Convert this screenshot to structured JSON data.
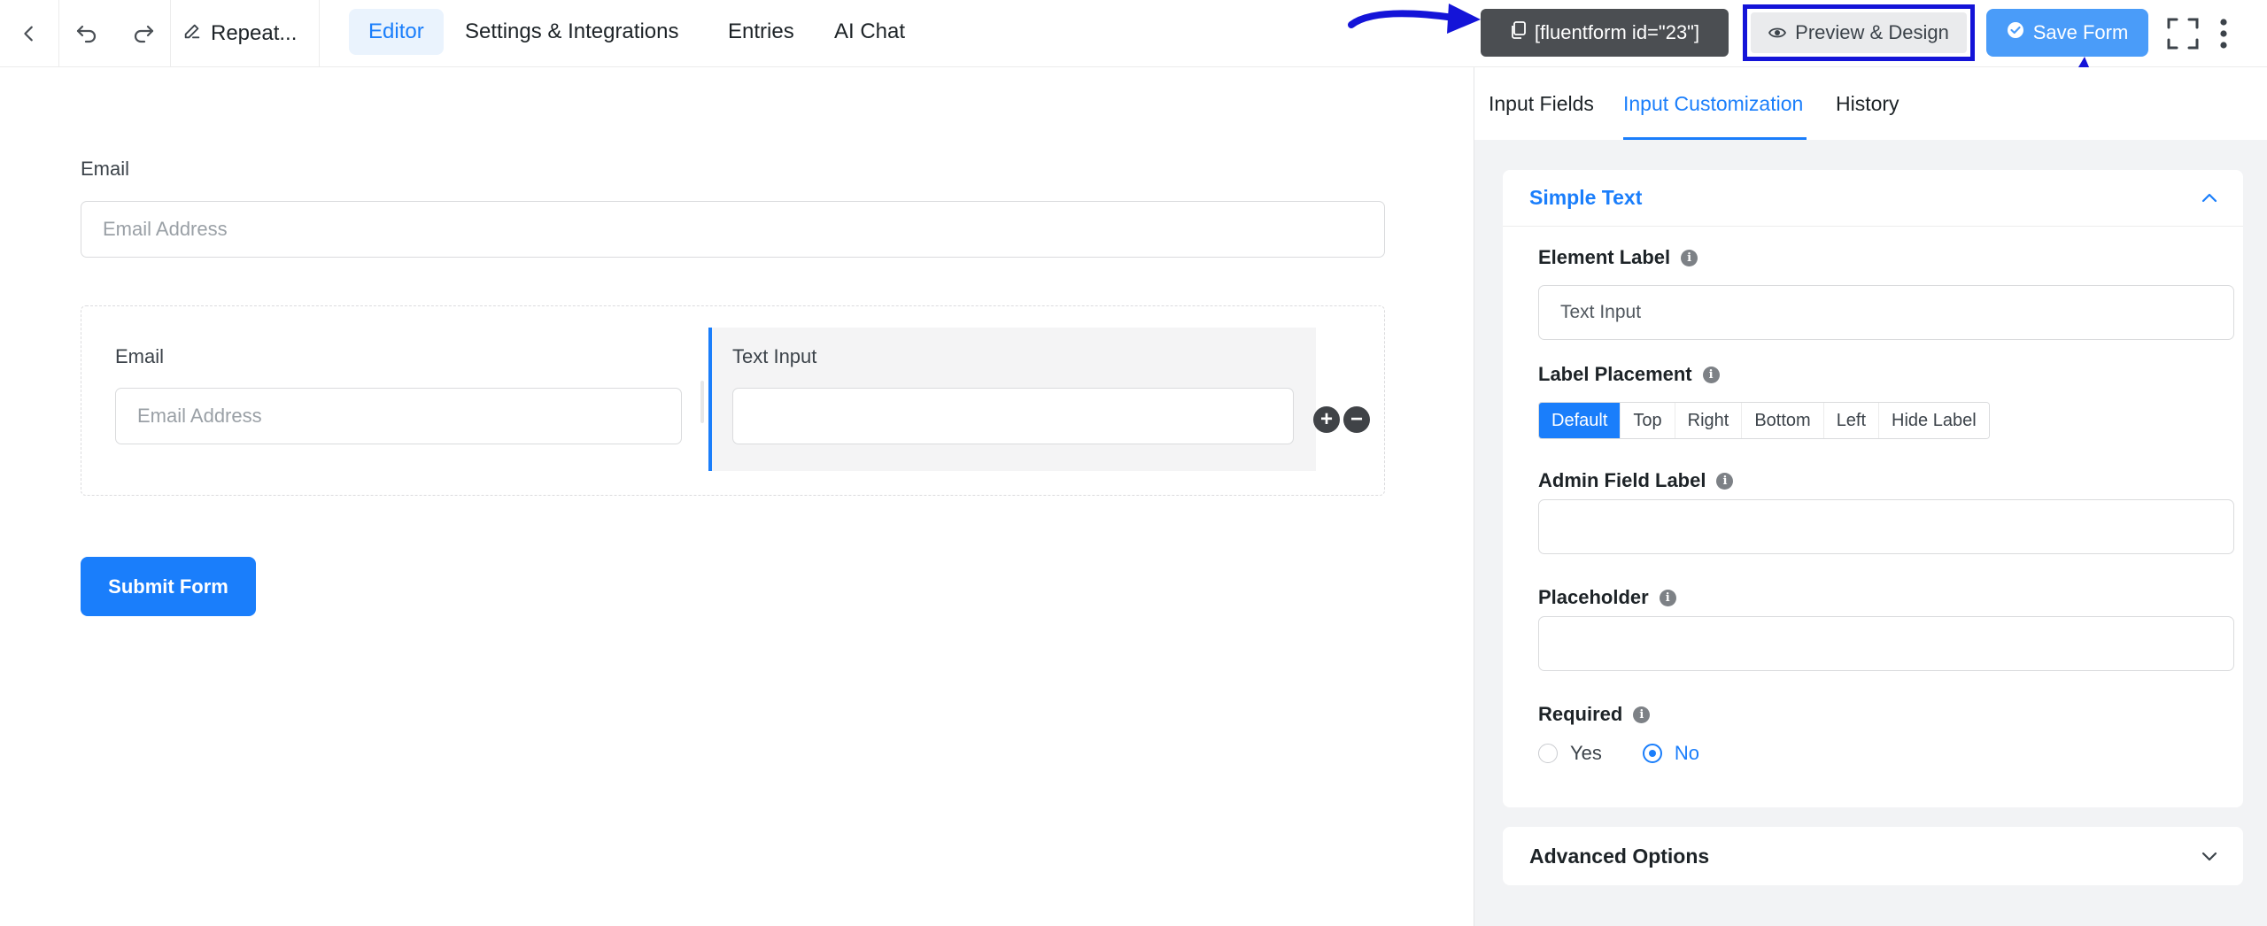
{
  "topbar": {
    "form_name": "Repeat...",
    "tabs": [
      {
        "label": "Editor",
        "active": true
      },
      {
        "label": "Settings & Integrations",
        "active": false
      },
      {
        "label": "Entries",
        "active": false
      },
      {
        "label": "AI Chat",
        "active": false
      }
    ],
    "shortcode": "[fluentform id=\"23\"]",
    "preview_label": "Preview & Design",
    "save_label": "Save Form",
    "icons": [
      "back-icon",
      "undo-icon",
      "redo-icon",
      "edit-icon",
      "copy-icon",
      "eye-icon",
      "check-circle-icon",
      "fullscreen-icon",
      "more-vertical-icon"
    ]
  },
  "canvas": {
    "email_field": {
      "label": "Email",
      "placeholder": "Email Address"
    },
    "repeater": {
      "col1": {
        "label": "Email",
        "placeholder": "Email Address"
      },
      "col2": {
        "label": "Text Input",
        "placeholder": ""
      }
    },
    "submit_label": "Submit Form"
  },
  "panel": {
    "tabs": [
      {
        "label": "Input Fields",
        "active": false
      },
      {
        "label": "Input Customization",
        "active": true
      },
      {
        "label": "History",
        "active": false
      }
    ],
    "section_title": "Simple Text",
    "element_label": {
      "label": "Element Label",
      "value": "Text Input"
    },
    "label_placement": {
      "label": "Label Placement",
      "options": [
        "Default",
        "Top",
        "Right",
        "Bottom",
        "Left",
        "Hide Label"
      ],
      "selected": "Default"
    },
    "admin_field_label": {
      "label": "Admin Field Label",
      "value": ""
    },
    "placeholder": {
      "label": "Placeholder",
      "value": ""
    },
    "required": {
      "label": "Required",
      "options": [
        "Yes",
        "No"
      ],
      "selected": "No"
    },
    "advanced_options": "Advanced Options",
    "info_glyph": "i"
  },
  "colors": {
    "accent": "#1a7efb",
    "annotation": "#1414d8",
    "shortcode_bg": "#4b4e52",
    "panel_bg": "#f2f3f5"
  }
}
